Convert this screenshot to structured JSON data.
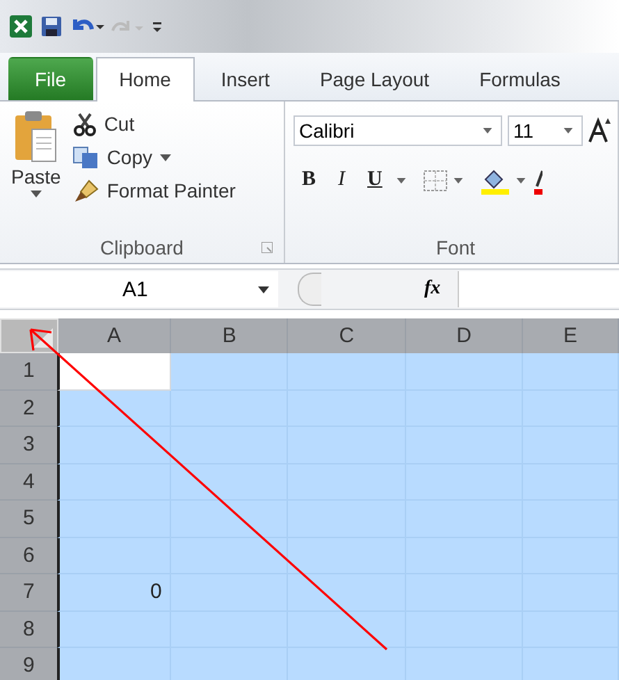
{
  "quick_access": {
    "kind": "toolbar"
  },
  "tabs": [
    {
      "label": "File",
      "kind": "file",
      "selected": false
    },
    {
      "label": "Home",
      "kind": "tab",
      "selected": true
    },
    {
      "label": "Insert",
      "kind": "tab",
      "selected": false
    },
    {
      "label": "Page Layout",
      "kind": "tab",
      "selected": false
    },
    {
      "label": "Formulas",
      "kind": "tab",
      "selected": false
    }
  ],
  "clipboard": {
    "paste": "Paste",
    "cut": "Cut",
    "copy": "Copy",
    "format_painter": "Format Painter",
    "title": "Clipboard"
  },
  "font": {
    "name": "Calibri",
    "size": "11",
    "bold": "B",
    "italic": "I",
    "underline": "U",
    "title": "Font"
  },
  "formula_bar": {
    "name_box": "A1",
    "fx": "fx"
  },
  "sheet": {
    "select_all": true,
    "columns": [
      "A",
      "B",
      "C",
      "D",
      "E"
    ],
    "rows": [
      {
        "label": "1",
        "cells": [
          {
            "active": true
          },
          {
            "active": false
          },
          {
            "active": false
          },
          {
            "active": false
          },
          {
            "active": false
          }
        ]
      },
      {
        "label": "2",
        "cells": [
          {
            "active": false
          },
          {
            "active": false
          },
          {
            "active": false
          },
          {
            "active": false
          },
          {
            "active": false
          }
        ]
      },
      {
        "label": "3",
        "cells": [
          {
            "active": false
          },
          {
            "active": false
          },
          {
            "active": false
          },
          {
            "active": false
          },
          {
            "active": false
          }
        ]
      },
      {
        "label": "4",
        "cells": [
          {
            "active": false
          },
          {
            "active": false
          },
          {
            "active": false
          },
          {
            "active": false
          },
          {
            "active": false
          }
        ]
      },
      {
        "label": "5",
        "cells": [
          {
            "active": false
          },
          {
            "active": false
          },
          {
            "active": false
          },
          {
            "active": false
          },
          {
            "active": false
          }
        ]
      },
      {
        "label": "6",
        "cells": [
          {
            "active": false
          },
          {
            "active": false
          },
          {
            "active": false
          },
          {
            "active": false
          },
          {
            "active": false
          }
        ]
      },
      {
        "label": "7",
        "cells": [
          {
            "active": false,
            "text": "0"
          },
          {
            "active": false
          },
          {
            "active": false
          },
          {
            "active": false
          },
          {
            "active": false
          }
        ]
      },
      {
        "label": "8",
        "cells": [
          {
            "active": false
          },
          {
            "active": false
          },
          {
            "active": false
          },
          {
            "active": false
          },
          {
            "active": false
          }
        ]
      },
      {
        "label": "9",
        "cells": [
          {
            "active": false
          },
          {
            "active": false
          },
          {
            "active": false
          },
          {
            "active": false
          },
          {
            "active": false
          }
        ]
      }
    ]
  },
  "annotation": {
    "kind": "arrow",
    "color": "#ff0000"
  }
}
